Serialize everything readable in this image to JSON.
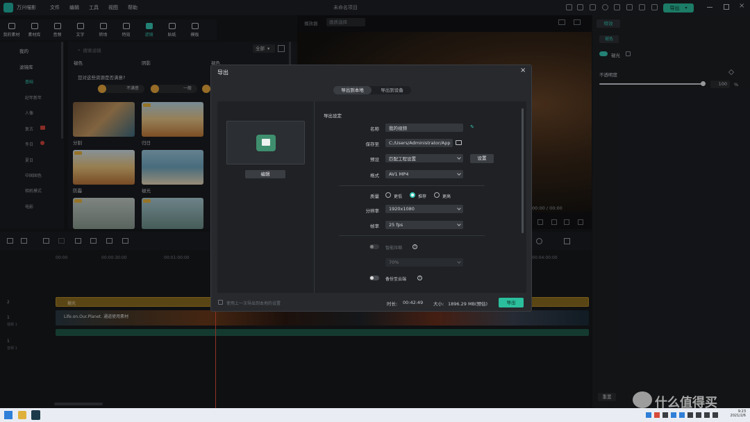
{
  "app": {
    "name": "万兴喵影",
    "menu": [
      "文件",
      "编辑",
      "工具",
      "视图",
      "帮助"
    ],
    "project_title": "未命名项目",
    "export_button": "导出"
  },
  "toolbar": {
    "items": [
      "我的素材",
      "素材库",
      "音频",
      "文字",
      "转场",
      "特效",
      "滤镜",
      "贴纸",
      "模板"
    ],
    "active_index": 6
  },
  "leftnav": {
    "items": [
      "我的",
      "滤镜库",
      "基础",
      "纪年新年",
      "人像",
      "复古",
      "冬日",
      "夏日",
      "中国国色",
      "相机模式",
      "电影"
    ],
    "selected": "基础"
  },
  "library": {
    "search_placeholder": "搜索滤镜",
    "filter_label": "全部",
    "columns": [
      "褪色",
      "阴影",
      "褪色"
    ],
    "feedback_question": "您对这些资源是否满意?",
    "feedback_options": [
      "不满意",
      "一般",
      "满意"
    ],
    "thumbs": [
      {
        "label": "分割",
        "vip": true
      },
      {
        "label": "归日",
        "vip": true
      },
      {
        "label": "防霾",
        "vip": true
      },
      {
        "label": "褪光",
        "vip": false
      },
      {
        "label": "",
        "vip": true
      },
      {
        "label": "",
        "vip": true
      }
    ]
  },
  "preview": {
    "dropdown": "画质选择",
    "time": "00:00",
    "total": "00:00"
  },
  "rightpanel": {
    "tab": "特效",
    "subtab": "褪色",
    "enable_label": "褪光",
    "opacity_label": "不透明度",
    "opacity_value": "100",
    "opacity_unit": "%",
    "reset_button": "重置"
  },
  "timeline": {
    "ruler": [
      "00:00",
      "00:00:30:00",
      "00:01:00:00",
      "00:04:00:00"
    ],
    "tracks": [
      {
        "id": "2",
        "label": "视频 2",
        "clip": "褪光"
      },
      {
        "id": "1",
        "label": "视频 1",
        "clip": "Life.on.Our.Planet. 通道使用素材"
      },
      {
        "id": "1",
        "label": "音频 1",
        "clip": ""
      }
    ]
  },
  "dialog": {
    "title": "导出",
    "tabs": [
      "导出到本地",
      "导出到设备"
    ],
    "active_tab": 0,
    "edit_button": "编辑",
    "section_title": "导出设定",
    "fields": {
      "name_label": "名称",
      "name_value": "我的视频",
      "save_label": "保存至",
      "save_value": "C:/Users/Administrator/App",
      "preset_label": "预设",
      "preset_value": "匹配工程设置",
      "preset_settings": "设置",
      "format_label": "格式",
      "format_value": "AV1 MP4",
      "quality_label": "质量",
      "quality_options": [
        "更低",
        "推荐",
        "更高"
      ],
      "quality_selected": 1,
      "resolution_label": "分辨率",
      "resolution_value": "1920x1080",
      "framerate_label": "帧率",
      "framerate_value": "25 fps",
      "compress_label": "智能压缩",
      "compress_value": "70%",
      "cloud_label": "备份至云端"
    },
    "footer": {
      "reuse_label": "使用上一次导出到本地的设置",
      "duration_label": "时长:",
      "duration_value": "00:42:49",
      "size_label": "大小:",
      "size_value": "1896.29 MB(预估)",
      "export_button": "导出"
    }
  },
  "taskbar": {
    "time": "9:23",
    "date": "2021/2/6"
  },
  "watermark": "值 什么值得买"
}
